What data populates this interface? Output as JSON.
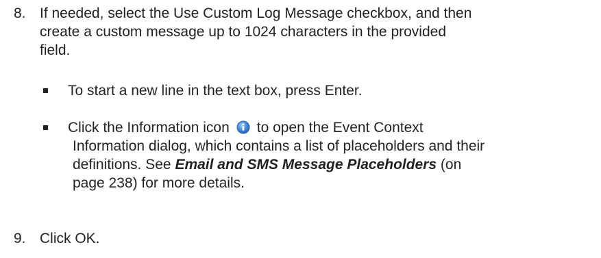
{
  "steps": {
    "step8": {
      "number": "8.",
      "line1": "If needed, select the Use Custom Log Message checkbox, and then",
      "line2": "create a custom message up to 1024 characters in the provided",
      "line3": "field."
    },
    "step9": {
      "number": "9.",
      "text": "Click OK."
    }
  },
  "bullets": {
    "b1": {
      "text": "To start a new line in the text box, press Enter."
    },
    "b2": {
      "before_icon": "Click the Information icon",
      "icon": "information-icon",
      "after_icon": "to open the Event Context",
      "line2": "Information dialog, which contains a list of placeholders and their",
      "line3_before": "definitions. See ",
      "line3_ref": "Email and SMS Message Placeholders",
      "line3_after": " (on",
      "line4": "page 238) for more details."
    }
  },
  "colors": {
    "text": "#222222",
    "icon_blue": "#3b7fd0"
  }
}
